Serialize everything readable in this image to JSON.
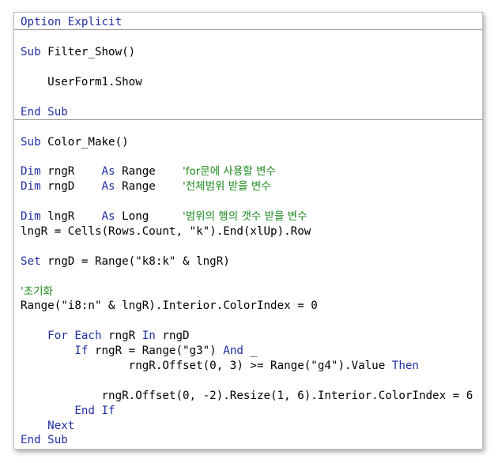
{
  "editor": {
    "header": {
      "option_kw": "Option",
      "explicit_kw": " Explicit"
    },
    "sub1": {
      "sub_kw": "Sub",
      "name": " Filter_Show()",
      "body": "    UserForm1.Show",
      "end_kw": "End Sub"
    },
    "sub2": {
      "sub_kw": "Sub",
      "name": " Color_Make()",
      "dim1": {
        "kw": "Dim",
        "var": " rngR    ",
        "as": "As",
        "type": " Range    ",
        "comment": "'for문에 사용할 변수"
      },
      "dim2": {
        "kw": "Dim",
        "var": " rngD    ",
        "as": "As",
        "type": " Range    ",
        "comment": "'전체범위 받을 변수"
      },
      "dim3": {
        "kw": "Dim",
        "var": " lngR    ",
        "as": "As",
        "type": " Long     ",
        "comment": "'범위의 행의 갯수 받을 변수"
      },
      "assign_lngR": "lngR = Cells(Rows.Count, \"k\").End(xlUp).Row",
      "set_kw": "Set",
      "set_rest": " rngD = Range(\"k8:k\" & lngR)",
      "init_comment": "'초기화",
      "clear_line": "Range(\"i8:n\" & lngR).Interior.ColorIndex = 0",
      "for_indent": "    ",
      "for_kw": "For Each",
      "for_var": " rngR ",
      "in_kw": "In",
      "for_coll": " rngD",
      "if_indent": "        ",
      "if_kw": "If",
      "if_cond": " rngR = Range(\"g3\") ",
      "and_kw": "And",
      "if_cont": " _",
      "cond2": "                rngR.Offset(0, 3) >= Range(\"g4\").Value ",
      "then_kw": "Then",
      "resize_line": "            rngR.Offset(0, -2).Resize(1, 6).Interior.ColorIndex = 6",
      "endif_indent": "        ",
      "endif_kw": "End If",
      "next_indent": "    ",
      "next_kw": "Next",
      "end_kw": "End Sub"
    }
  },
  "colors": {
    "keyword": "#1f2ea3",
    "comment": "#1a8a1a",
    "text": "#000000",
    "separator": "#9a9a9a"
  }
}
